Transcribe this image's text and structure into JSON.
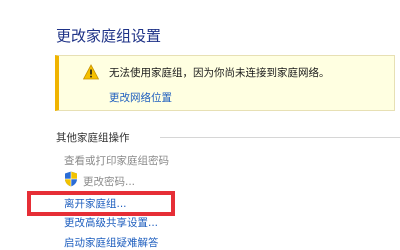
{
  "page": {
    "title": "更改家庭组设置"
  },
  "warning": {
    "icon": "warning-icon",
    "message": "无法使用家庭组，因为你尚未连接到家庭网络。",
    "link": "更改网络位置"
  },
  "other_ops": {
    "section_title": "其他家庭组操作",
    "items": [
      {
        "label": "查看或打印家庭组密码",
        "state": "disabled"
      },
      {
        "label": "更改密码...",
        "state": "disabled",
        "icon": "uac-shield-icon"
      },
      {
        "label": "离开家庭组...",
        "state": "link",
        "highlighted": true
      },
      {
        "label": "更改高级共享设置...",
        "state": "link"
      },
      {
        "label": "启动家庭组疑难解答",
        "state": "link"
      }
    ]
  },
  "colors": {
    "title": "#1e3287",
    "link": "#1f5fbf",
    "disabled": "#8a8a8a",
    "warning_bg": "#ffffe1",
    "warning_accent": "#f0b400",
    "highlight": "#e62e36"
  }
}
